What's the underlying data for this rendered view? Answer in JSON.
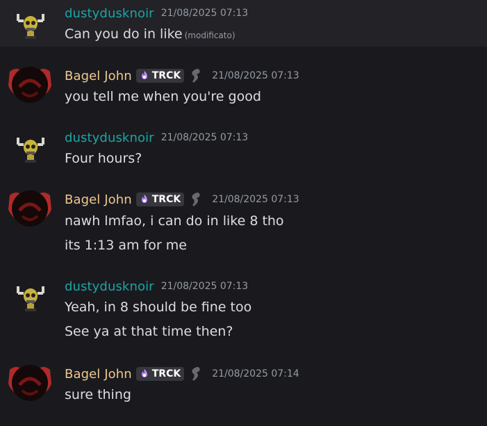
{
  "messages": [
    {
      "username": "dustydusknoir",
      "timestamp": "21/08/2025 07:13",
      "lines": [
        "Can you do in like"
      ],
      "edited": "(modificato)"
    },
    {
      "username": "Bagel John",
      "tag": "TRCK",
      "timestamp": "21/08/2025 07:13",
      "lines": [
        "you tell me when you're good"
      ]
    },
    {
      "username": "dustydusknoir",
      "timestamp": "21/08/2025 07:13",
      "lines": [
        "Four hours?"
      ]
    },
    {
      "username": "Bagel John",
      "tag": "TRCK",
      "timestamp": "21/08/2025 07:13",
      "lines": [
        "nawh lmfao, i can do in like 8 tho",
        "its 1:13 am for me"
      ]
    },
    {
      "username": "dustydusknoir",
      "timestamp": "21/08/2025 07:13",
      "lines": [
        "Yeah, in 8 should be fine too",
        "See ya at that time then?"
      ]
    },
    {
      "username": "Bagel John",
      "tag": "TRCK",
      "timestamp": "21/08/2025 07:14",
      "lines": [
        "sure thing"
      ]
    }
  ],
  "colors": {
    "background": "#1a1a1e",
    "highlight": "#222227",
    "dustydusknoir_name": "#1aa6a6",
    "bagel_john_name": "#f0c890",
    "message_text": "#dbdee1",
    "timestamp": "#949ba4",
    "tag_bg": "#36363d"
  }
}
